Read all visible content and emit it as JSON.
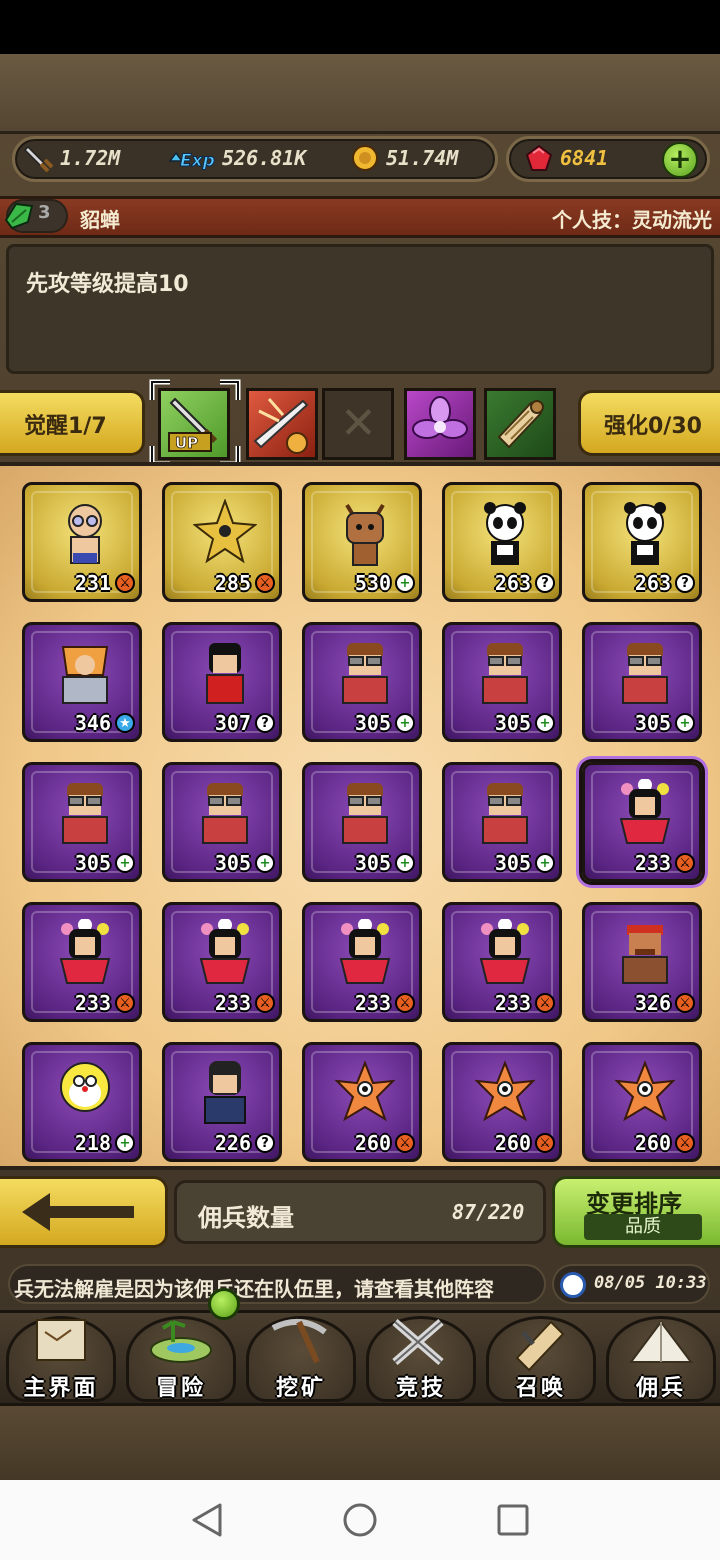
{
  "resources": {
    "attack": "1.72M",
    "exp": "526.81K",
    "gold": "51.74M",
    "gems": "6841",
    "add_button": "+"
  },
  "hero": {
    "level_badge": "3",
    "name": "貂蝉",
    "personal_skill": "个人技：灵动流光",
    "description": "先攻等级提高10"
  },
  "skills": {
    "awaken": "觉醒1/7",
    "enhance": "强化0/30",
    "up_label": "UP"
  },
  "mercenaries": [
    {
      "level": "231",
      "badge": "sword",
      "frame": "gold",
      "sprite": "bald-glasses"
    },
    {
      "level": "285",
      "badge": "sword",
      "frame": "gold",
      "sprite": "star"
    },
    {
      "level": "530",
      "badge": "plus",
      "frame": "gold",
      "sprite": "deer"
    },
    {
      "level": "263",
      "badge": "question",
      "frame": "gold",
      "sprite": "panda"
    },
    {
      "level": "263",
      "badge": "question",
      "frame": "gold",
      "sprite": "panda"
    },
    {
      "level": "346",
      "badge": "star",
      "frame": "purple",
      "sprite": "armored"
    },
    {
      "level": "307",
      "badge": "question",
      "frame": "purple",
      "sprite": "red-shirt"
    },
    {
      "level": "305",
      "badge": "plus",
      "frame": "purple",
      "sprite": "goggles"
    },
    {
      "level": "305",
      "badge": "plus",
      "frame": "purple",
      "sprite": "goggles"
    },
    {
      "level": "305",
      "badge": "plus",
      "frame": "purple",
      "sprite": "goggles"
    },
    {
      "level": "305",
      "badge": "plus",
      "frame": "purple",
      "sprite": "goggles"
    },
    {
      "level": "305",
      "badge": "plus",
      "frame": "purple",
      "sprite": "goggles"
    },
    {
      "level": "305",
      "badge": "plus",
      "frame": "purple",
      "sprite": "goggles"
    },
    {
      "level": "305",
      "badge": "plus",
      "frame": "purple",
      "sprite": "goggles"
    },
    {
      "level": "233",
      "badge": "sword",
      "frame": "purple",
      "sprite": "flower-crown",
      "selected": true
    },
    {
      "level": "233",
      "badge": "sword",
      "frame": "purple",
      "sprite": "flower-crown"
    },
    {
      "level": "233",
      "badge": "sword",
      "frame": "purple",
      "sprite": "flower-crown"
    },
    {
      "level": "233",
      "badge": "sword",
      "frame": "purple",
      "sprite": "flower-crown"
    },
    {
      "level": "233",
      "badge": "sword",
      "frame": "purple",
      "sprite": "flower-crown"
    },
    {
      "level": "326",
      "badge": "sword",
      "frame": "purple",
      "sprite": "bandana"
    },
    {
      "level": "218",
      "badge": "plus",
      "frame": "purple",
      "sprite": "robot-cat"
    },
    {
      "level": "226",
      "badge": "question",
      "frame": "purple",
      "sprite": "ninja"
    },
    {
      "level": "260",
      "badge": "sword",
      "frame": "purple",
      "sprite": "starfish"
    },
    {
      "level": "260",
      "badge": "sword",
      "frame": "purple",
      "sprite": "starfish"
    },
    {
      "level": "260",
      "badge": "sword",
      "frame": "purple",
      "sprite": "starfish"
    }
  ],
  "footer": {
    "count_label": "佣兵数量",
    "count_value": "87/220",
    "sort_title": "变更排序",
    "sort_sub": "品质",
    "ticker": "兵无法解雇是因为该佣兵还在队伍里，请查看其他阵容",
    "time": "08/05 10:33"
  },
  "nav": [
    {
      "label": "主界面",
      "icon": "map-scroll-icon"
    },
    {
      "label": "冒险",
      "icon": "island-icon"
    },
    {
      "label": "挖矿",
      "icon": "pickaxe-icon"
    },
    {
      "label": "竞技",
      "icon": "crossed-swords-icon"
    },
    {
      "label": "召唤",
      "icon": "summon-scroll-icon"
    },
    {
      "label": "佣兵",
      "icon": "tent-icon"
    }
  ]
}
